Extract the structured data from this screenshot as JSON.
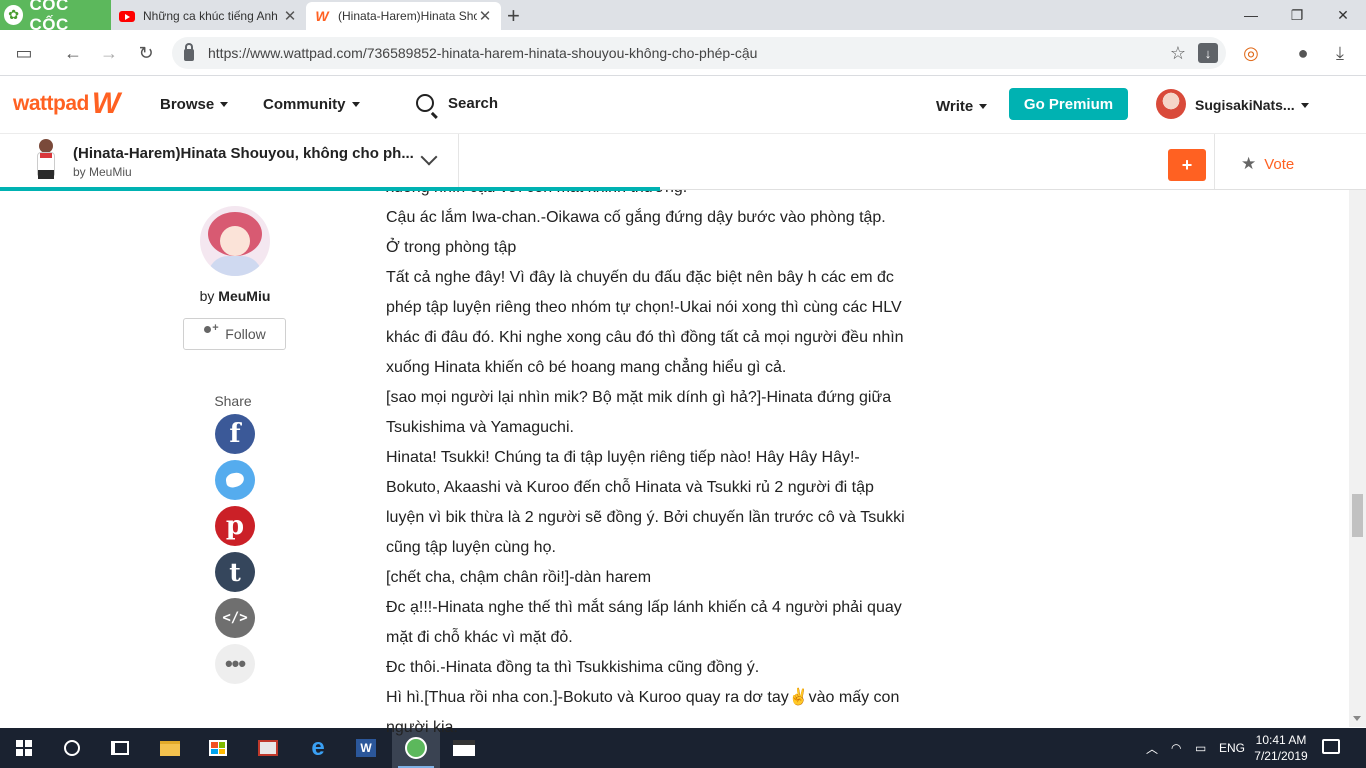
{
  "browser": {
    "brand": "CỐC CỐC",
    "tabs": [
      {
        "title": "Những ca khúc tiếng Anh",
        "favicon": "youtube-icon",
        "active": false
      },
      {
        "title": "(Hinata-Harem)Hinata Sho",
        "favicon": "wattpad-icon",
        "active": true
      }
    ],
    "url": "https://www.wattpad.com/736589852-hinata-harem-hinata-shouyou-không-cho-phép-cậu"
  },
  "header": {
    "logo": "wattpad",
    "browse": "Browse",
    "community": "Community",
    "search": "Search",
    "write": "Write",
    "premium": "Go Premium",
    "username": "SugisakiNats..."
  },
  "story_bar": {
    "title": "(Hinata-Harem)Hinata Shouyou, không cho ph...",
    "author": "by MeuMiu",
    "add_label": "+",
    "vote_label": "Vote",
    "reading_progress": 0.695
  },
  "author": {
    "by_prefix": "by",
    "name": "MeuMiu",
    "follow_label": "Follow"
  },
  "share": {
    "label": "Share",
    "buttons": [
      "facebook-icon",
      "twitter-icon",
      "pinterest-icon",
      "tumblr-icon",
      "embed-icon",
      "more-icon"
    ]
  },
  "story_lines": [
    "xuống nhìn cậu với con mắt khinh thường.",
    "Cậu ác lắm Iwa-chan.-Oikawa cố gắng đứng dậy bước vào phòng tập.",
    "Ở trong phòng tập",
    "Tất cả nghe đây! Vì đây là chuyến du đấu đặc biệt nên bây h các em đc",
    "phép tập luyện riêng theo nhóm tự chọn!-Ukai nói xong thì cùng các HLV",
    "khác đi đâu đó. Khi nghe xong câu đó thì đồng tất cả mọi người đều nhìn",
    "xuống Hinata khiến cô bé hoang mang chẳng hiểu gì cả.",
    "[sao mọi người lại nhìn mik? Bộ mặt mik dính gì hả?]-Hinata đứng giữa",
    "Tsukishima và Yamaguchi.",
    "Hinata! Tsukki! Chúng ta đi tập luyện riêng tiếp nào! Hây Hây Hây!-",
    "Bokuto, Akaashi và Kuroo đến chỗ Hinata và Tsukki rủ 2 người đi tập",
    "luyện vì bik thừa là 2 người sẽ đồng ý. Bởi chuyến lần trước cô và Tsukki",
    "cũng tập luyện cùng họ.",
    "[chết cha, chậm chân rồi!]-dàn harem",
    "Đc ạ!!!-Hinata nghe thế thì mắt sáng lấp lánh khiến cả 4 người phải quay",
    "mặt đi chỗ khác vì mặt đỏ.",
    "Đc thôi.-Hinata đồng ta thì Tsukkishima cũng đồng ý.",
    "Hì hì.[Thua rồi nha con.]-Bokuto và Kuroo quay ra dơ tay✌️vào mấy con",
    "người kia."
  ],
  "taskbar": {
    "language": "ENG",
    "time": "10:41 AM",
    "date": "7/21/2019"
  },
  "colors": {
    "wattpad_orange": "#ff6122",
    "premium_teal": "#00b2b2",
    "coccoc_green": "#5cb85c"
  }
}
